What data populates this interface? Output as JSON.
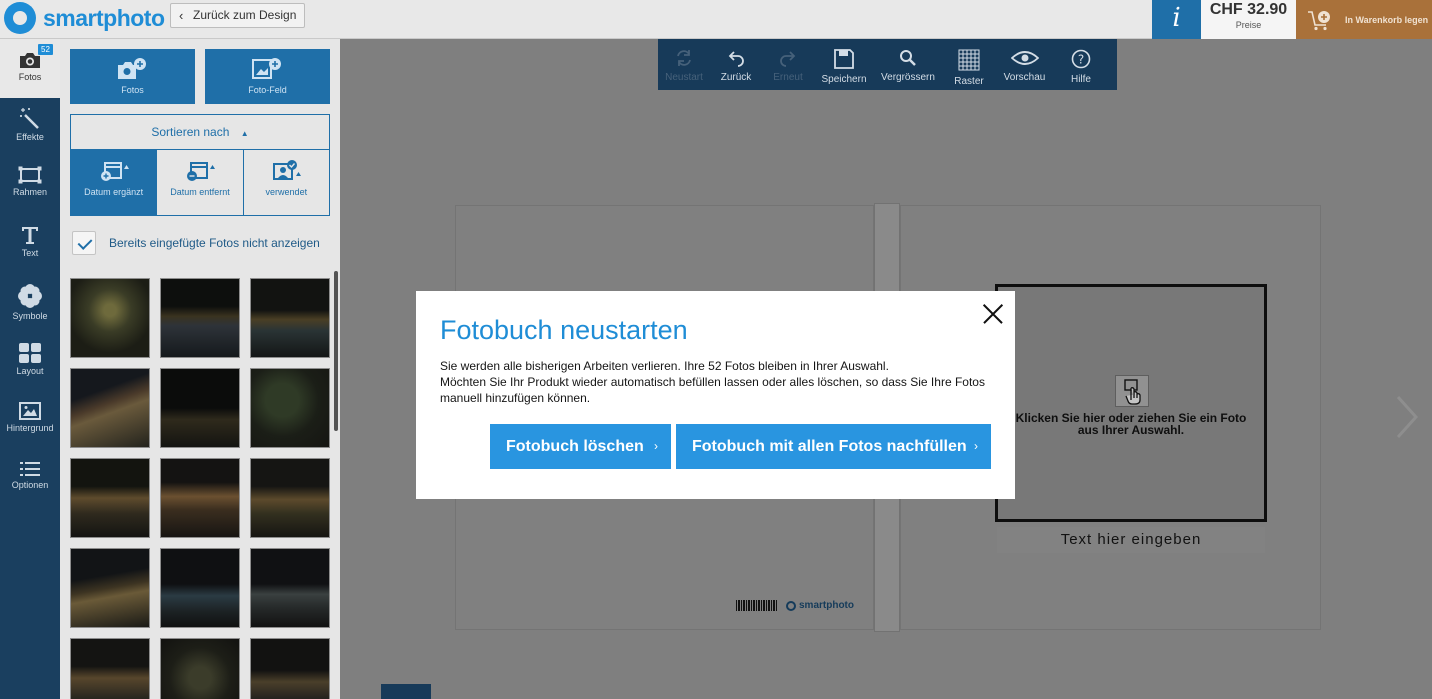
{
  "topbar": {
    "logo_text": "smartphoto",
    "back_label": "Zurück zum Design",
    "info_label": "i",
    "price": "CHF 32.90",
    "price_label": "Preise",
    "cart_label": "In Warenkorb legen"
  },
  "leftnav": {
    "badge": "52",
    "items": [
      {
        "label": "Fotos",
        "icon": "camera-icon"
      },
      {
        "label": "Effekte",
        "icon": "magic-wand-icon"
      },
      {
        "label": "Rahmen",
        "icon": "frame-icon"
      },
      {
        "label": "Text",
        "icon": "text-icon"
      },
      {
        "label": "Symbole",
        "icon": "flower-icon"
      },
      {
        "label": "Layout",
        "icon": "layout-icon"
      },
      {
        "label": "Hintergrund",
        "icon": "image-icon"
      },
      {
        "label": "Optionen",
        "icon": "list-icon"
      }
    ]
  },
  "panel": {
    "add_photos": "Fotos",
    "add_photo_field": "Foto-Feld",
    "sort_title": "Sortieren nach",
    "sort_options": [
      "Datum ergänzt",
      "Datum entfernt",
      "verwendet"
    ],
    "hide_inserted": "Bereits eingefügte Fotos nicht anzeigen",
    "photo_count_visible": 15
  },
  "toolbar": {
    "items": [
      {
        "label": "Neustart",
        "icon": "refresh-icon",
        "enabled": false
      },
      {
        "label": "Zurück",
        "icon": "undo-icon",
        "enabled": true
      },
      {
        "label": "Erneut",
        "icon": "redo-icon",
        "enabled": false
      },
      {
        "label": "Speichern",
        "icon": "save-icon",
        "enabled": true
      },
      {
        "label": "Vergrössern",
        "icon": "zoom-icon",
        "enabled": true
      },
      {
        "label": "Raster",
        "icon": "grid-icon",
        "enabled": true
      },
      {
        "label": "Vorschau",
        "icon": "eye-icon",
        "enabled": true
      },
      {
        "label": "Hilfe",
        "icon": "help-icon",
        "enabled": true
      }
    ]
  },
  "book": {
    "frame_prompt": "Klicken Sie hier oder ziehen Sie ein Foto aus Ihrer Auswahl.",
    "text_placeholder": "Text hier eingeben",
    "back_logo": "smartphoto"
  },
  "modal": {
    "title": "Fotobuch neustarten",
    "line1": "Sie werden alle bisherigen Arbeiten verlieren. Ihre 52 Fotos bleiben in Ihrer Auswahl.",
    "line2": "Möchten Sie Ihr Produkt wieder automatisch befüllen lassen oder alles löschen, so dass Sie Ihre Fotos manuell hinzufügen können.",
    "delete_label": "Fotobuch löschen",
    "refill_label": "Fotobuch mit allen Fotos nachfüllen"
  },
  "colors": {
    "brand_blue": "#1f8dd6",
    "nav_dark": "#1a3f5f",
    "button_blue": "#2995e0",
    "cart_orange": "#a9713a"
  }
}
